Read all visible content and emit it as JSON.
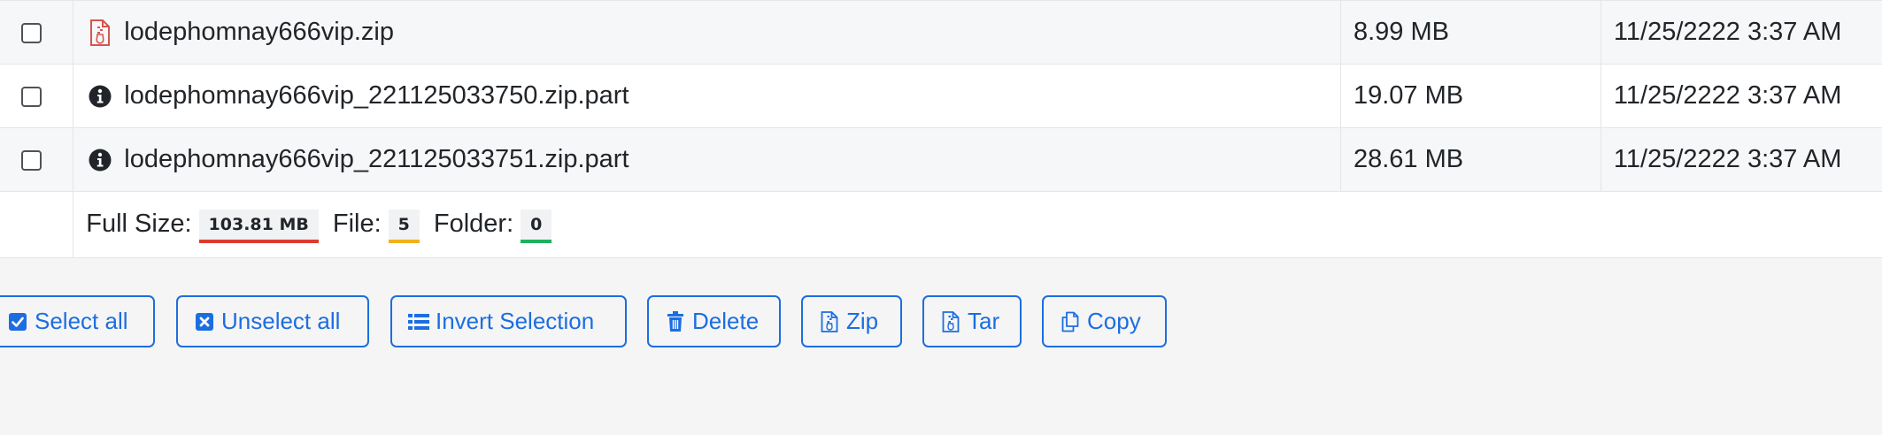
{
  "files": [
    {
      "icon": "zip-file-icon",
      "name": "lodephomnay666vip.zip",
      "size": "8.99 MB",
      "modified": "11/25/2222 3:37 AM"
    },
    {
      "icon": "info-circle-icon",
      "name": "lodephomnay666vip_221125033750.zip.part",
      "size": "19.07 MB",
      "modified": "11/25/2222 3:37 AM"
    },
    {
      "icon": "info-circle-icon",
      "name": "lodephomnay666vip_221125033751.zip.part",
      "size": "28.61 MB",
      "modified": "11/25/2222 3:37 AM"
    }
  ],
  "summary": {
    "full_size_label": "Full Size:",
    "full_size_value": "103.81 MB",
    "file_label": "File:",
    "file_count": "5",
    "folder_label": "Folder:",
    "folder_count": "0"
  },
  "actions": {
    "select_all": "Select all",
    "unselect_all": "Unselect all",
    "invert_selection": "Invert Selection",
    "delete": "Delete",
    "zip": "Zip",
    "tar": "Tar",
    "copy": "Copy"
  },
  "colors": {
    "accent": "#1c6ee0",
    "zip_icon": "#d9534f",
    "size_badge": "#dc3b2f",
    "file_badge": "#f0b21b",
    "folder_badge": "#1fb15c"
  }
}
